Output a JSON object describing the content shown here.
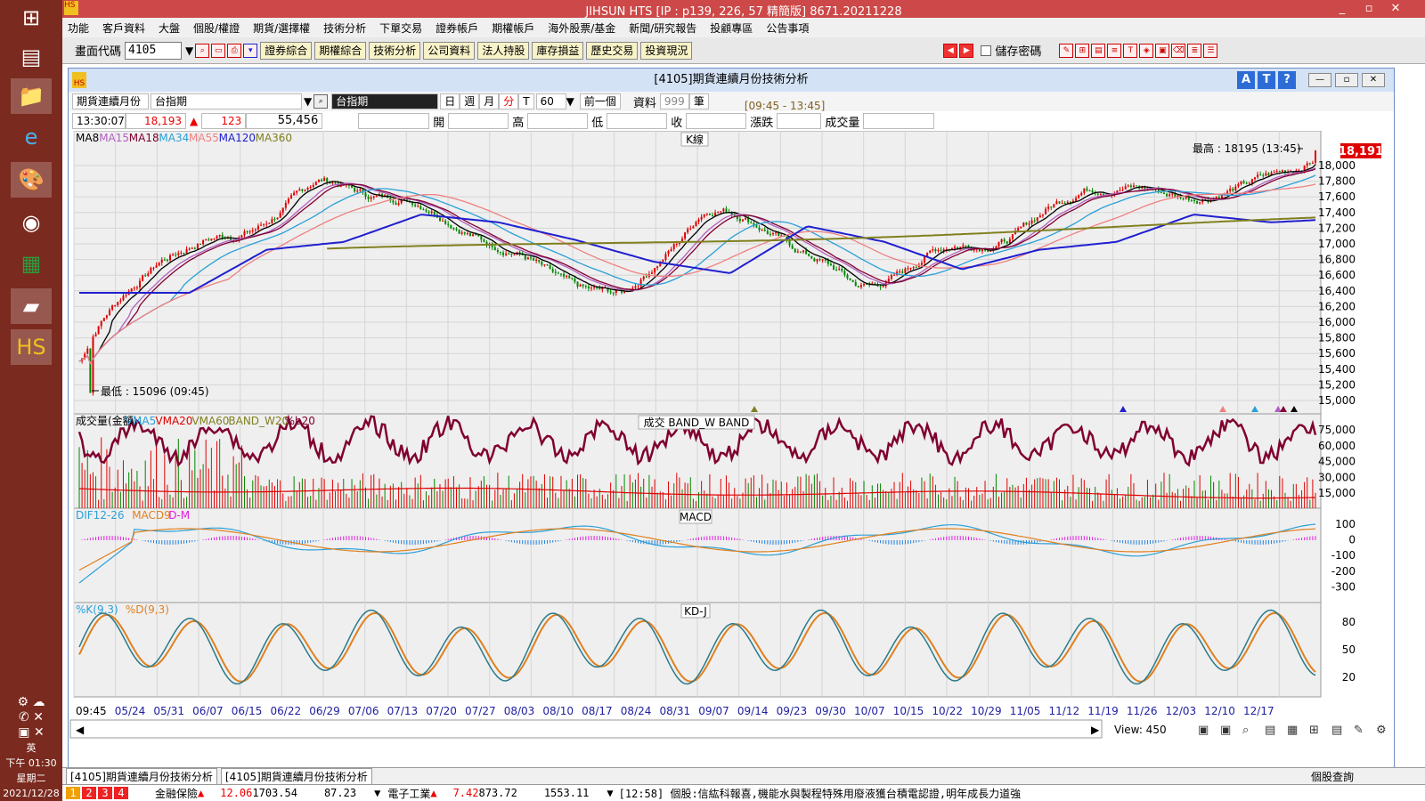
{
  "window": {
    "title": "JIHSUN HTS     [IP : p139, 226, 57 精簡版] 8671.20211228",
    "min": "_",
    "restore": "▫",
    "close": "✕"
  },
  "menu": [
    "功能",
    "客戶資料",
    "大盤",
    "個股/權證",
    "期貨/選擇權",
    "技術分析",
    "下單交易",
    "證券帳戶",
    "期權帳戶",
    "海外股票/基金",
    "新聞/研究報告",
    "投顧專區",
    "公告事項"
  ],
  "toolbar": {
    "screen_label": "畫面代碼",
    "screen_code": "4105",
    "buttons": [
      "證券綜合",
      "期權綜合",
      "技術分析",
      "公司資料",
      "法人持股",
      "庫存損益",
      "歷史交易",
      "投資現況"
    ],
    "save_pwd": "儲存密碼"
  },
  "child": {
    "title": "[4105]期貨連續月份技術分析",
    "btn_a": "A",
    "btn_t": "T",
    "btn_q": "?"
  },
  "ctrl": {
    "contract": "期貨連續月份",
    "symbol": "台指期",
    "symbol2": "台指期",
    "period_day": "日",
    "period_week": "週",
    "period_month": "月",
    "period_min": "分",
    "period_t": "T",
    "interval": "60",
    "prev": "前一個",
    "data_label": "資料",
    "data_count": "999",
    "unit": "筆",
    "session": "[09:45 - 13:45]"
  },
  "quote": {
    "time": "13:30:07",
    "price": "18,193",
    "change": "123",
    "volume": "55,456",
    "open": "開",
    "high": "高",
    "low": "低",
    "close": "收",
    "chg": "漲跌",
    "vol": "成交量"
  },
  "panels": {
    "k_title": "K線",
    "k_legend": [
      {
        "t": "MA8",
        "c": "#000000"
      },
      {
        "t": "MA15",
        "c": "#b060c0"
      },
      {
        "t": "MA18",
        "c": "#800030"
      },
      {
        "t": "MA34",
        "c": "#2aa0d8"
      },
      {
        "t": "MA55",
        "c": "#f08080"
      },
      {
        "t": "MA120",
        "c": "#2020d0"
      },
      {
        "t": "MA360",
        "c": "#808020"
      }
    ],
    "high_note": "最高 : 18195 (13:45)",
    "low_note": "最低 : 15096 (09:45)",
    "last_price": "18,191",
    "y_ticks": [
      "18,000",
      "17,800",
      "17,600",
      "17,400",
      "17,200",
      "17,000",
      "16,800",
      "16,600",
      "16,400",
      "16,200",
      "16,000",
      "15,800",
      "15,600",
      "15,400",
      "15,200",
      "15,000"
    ],
    "vol_title": "成交   BAND_W   BAND",
    "vol_legend": [
      {
        "t": "成交量(金額)",
        "c": "#000000"
      },
      {
        "t": "VMA5",
        "c": "#2aa0d8"
      },
      {
        "t": "VMA20",
        "c": "#e00000"
      },
      {
        "t": "VMA60",
        "c": "#808020"
      },
      {
        "t": "BAND_W20",
        "c": "#808020"
      },
      {
        "t": "%b20",
        "c": "#800030"
      }
    ],
    "vol_ticks": [
      "75,000",
      "60,000",
      "45,000",
      "30,000",
      "15,000"
    ],
    "macd_title": "MACD",
    "macd_legend": [
      {
        "t": "DIF12-26",
        "c": "#2aa0d8"
      },
      {
        "t": "MACD9",
        "c": "#e08020"
      },
      {
        "t": "D-M",
        "c": "#e020e0"
      }
    ],
    "macd_ticks": [
      "100",
      "0",
      "-100",
      "-200",
      "-300"
    ],
    "kd_title": "KD-J",
    "kd_legend": [
      {
        "t": "%K(9,3)",
        "c": "#2aa0d8"
      },
      {
        "t": "%D(9,3)",
        "c": "#e08020"
      }
    ],
    "kd_ticks": [
      "80",
      "50",
      "20"
    ]
  },
  "x_labels": [
    "09:45",
    "05/24",
    "05/31",
    "06/07",
    "06/15",
    "06/22",
    "06/29",
    "07/06",
    "07/13",
    "07/20",
    "07/27",
    "08/03",
    "08/10",
    "08/17",
    "08/24",
    "08/31",
    "09/07",
    "09/14",
    "09/23",
    "09/30",
    "10/07",
    "10/15",
    "10/22",
    "10/29",
    "11/05",
    "11/12",
    "11/19",
    "11/26",
    "12/03",
    "12/10",
    "12/17"
  ],
  "view": {
    "label": "View:",
    "value": "450"
  },
  "status": {
    "tab1": "[4105]期貨連續月份技術分析",
    "tab2": "[4105]期貨連續月份技術分析",
    "right": "個股查詢"
  },
  "ticker": {
    "pages": [
      "1",
      "2",
      "3",
      "4"
    ],
    "item1": "金融保險",
    "item1_chg": "12.06",
    "item1_val": "1703.54",
    "item1_vol": "87.23",
    "item2": "電子工業",
    "item2_chg": "7.42",
    "item2_val": "873.72",
    "item2_vol": "1553.11",
    "news": "[12:58] 個股:信紘科報喜,機能水與製程特殊用廢液獲台積電認證,明年成長力道強"
  },
  "tray": {
    "lang": "英",
    "time": "下午 01:30",
    "weekday": "星期二",
    "date": "2021/12/28"
  },
  "chart_data": {
    "type": "candlestick",
    "series_note": "台指期 60-minute K line, 450 bars",
    "ma_anchor": {
      "x": [
        "05/24",
        "06/07",
        "06/22",
        "07/06",
        "07/20",
        "08/03",
        "08/17",
        "08/24",
        "09/07",
        "09/23",
        "10/07",
        "10/22",
        "11/05",
        "11/19",
        "12/03",
        "12/17",
        "12/28"
      ],
      "price": [
        15800,
        16900,
        17100,
        17800,
        17600,
        17150,
        16600,
        16300,
        17500,
        17100,
        16400,
        16900,
        17100,
        17800,
        17600,
        17700,
        18191
      ]
    },
    "price_range": [
      15000,
      18200
    ],
    "high": 18195,
    "low": 15096
  }
}
